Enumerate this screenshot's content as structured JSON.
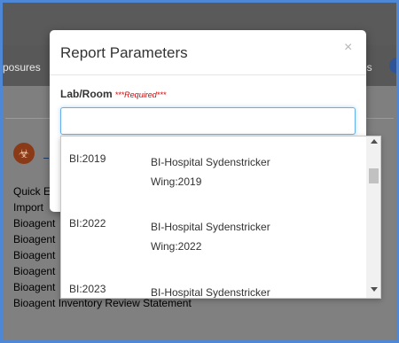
{
  "background": {
    "nav_left_text": "posures",
    "nav_right_text": "es",
    "list_items": [
      "Quick E",
      "Import",
      "Bioagent",
      "Bioagent",
      "Bioagent",
      "Bioagent",
      "Bioagent",
      "Bioagent Inventory Review Statement"
    ]
  },
  "modal": {
    "title": "Report Parameters",
    "close": "×",
    "field_label": "Lab/Room",
    "required_text": "***Required***",
    "input_value": ""
  },
  "dropdown": {
    "options": [
      {
        "code": "BI:2019",
        "name": "BI-Hospital Sydenstricker Wing:2019"
      },
      {
        "code": "BI:2022",
        "name": "BI-Hospital Sydenstricker Wing:2022"
      },
      {
        "code": "BI:2023",
        "name": "BI-Hospital Sydenstricker"
      }
    ]
  }
}
